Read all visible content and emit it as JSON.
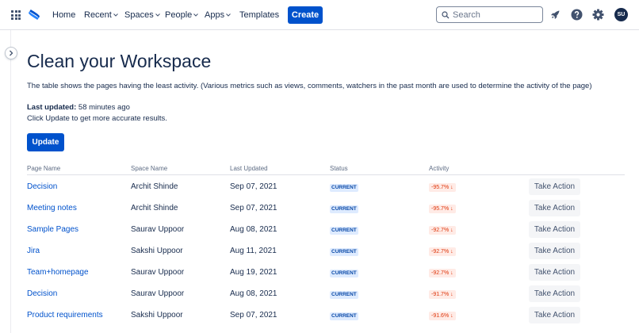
{
  "nav": {
    "items": [
      {
        "label": "Home",
        "has_chevron": false
      },
      {
        "label": "Recent",
        "has_chevron": true
      },
      {
        "label": "Spaces",
        "has_chevron": true
      },
      {
        "label": "People",
        "has_chevron": true
      },
      {
        "label": "Apps",
        "has_chevron": true
      },
      {
        "label": "Templates",
        "has_chevron": false
      }
    ],
    "create_label": "Create",
    "search_placeholder": "Search",
    "icons": [
      "app-switcher-icon",
      "confluence-logo-icon",
      "search-icon",
      "notifications-icon",
      "help-icon",
      "settings-icon"
    ],
    "avatar_initials": "SU",
    "accent_color": "#0052cc"
  },
  "page": {
    "title": "Clean your Workspace",
    "description": "The table shows the pages having the least activity. (Various metrics such as views, comments, watchers in the past month are used to determine the activity of the page)",
    "last_updated_label": "Last updated:",
    "last_updated_value": "58 minutes ago",
    "hint": "Click Update to get more accurate results.",
    "update_label": "Update"
  },
  "table": {
    "headers": [
      "Page Name",
      "Space Name",
      "Last Updated",
      "Status",
      "Activity"
    ],
    "action_label": "Take Action",
    "rows": [
      {
        "page": "Decision",
        "space": "Archit Shinde",
        "updated": "Sep 07, 2021",
        "status": "CURRENT",
        "activity": "-95.7% ↓"
      },
      {
        "page": "Meeting notes",
        "space": "Archit Shinde",
        "updated": "Sep 07, 2021",
        "status": "CURRENT",
        "activity": "-95.7% ↓"
      },
      {
        "page": "Sample Pages",
        "space": "Saurav Uppoor",
        "updated": "Aug 08, 2021",
        "status": "CURRENT",
        "activity": "-92.7% ↓"
      },
      {
        "page": "Jira",
        "space": "Sakshi Uppoor",
        "updated": "Aug 11, 2021",
        "status": "CURRENT",
        "activity": "-92.7% ↓"
      },
      {
        "page": "Team+homepage",
        "space": "Saurav Uppoor",
        "updated": "Aug 19, 2021",
        "status": "CURRENT",
        "activity": "-92.7% ↓"
      },
      {
        "page": "Decision",
        "space": "Saurav Uppoor",
        "updated": "Aug 08, 2021",
        "status": "CURRENT",
        "activity": "-91.7% ↓"
      },
      {
        "page": "Product requirements",
        "space": "Sakshi Uppoor",
        "updated": "Sep 07, 2021",
        "status": "CURRENT",
        "activity": "-91.6% ↓"
      }
    ]
  }
}
